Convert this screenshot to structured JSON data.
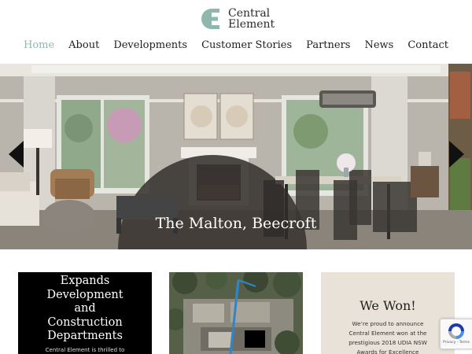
{
  "brand": {
    "line1": "Central",
    "line2": "Element",
    "accent_color": "#8fb7ae"
  },
  "nav": {
    "items": [
      {
        "label": "Home",
        "active": true
      },
      {
        "label": "About"
      },
      {
        "label": "Developments"
      },
      {
        "label": "Customer Stories"
      },
      {
        "label": "Partners"
      },
      {
        "label": "News"
      },
      {
        "label": "Contact"
      }
    ]
  },
  "hero": {
    "caption": "The Malton, Beecroft",
    "prev_icon": "arrow-left-icon",
    "next_icon": "arrow-right-icon"
  },
  "cards": [
    {
      "title_lines": [
        "Expands",
        "Development",
        "and",
        "Construction",
        "Departments"
      ],
      "body": "Central Element is thrilled to"
    },
    {
      "image": "construction site aerial photo"
    },
    {
      "title": "We Won!",
      "body_lines": [
        "We’re proud to announce",
        "Central Element won at the",
        "prestigious 2018 UDIA NSW",
        "Awards for Excellence"
      ]
    }
  ],
  "recaptcha": {
    "label": "Privacy - Terms",
    "icon": "recaptcha-icon"
  }
}
